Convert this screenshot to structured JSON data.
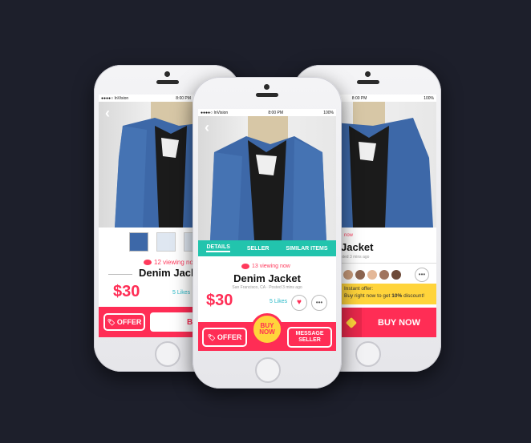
{
  "status_bar": {
    "carrier": "●●●●○ InVision",
    "time": "8:00 PM",
    "battery": "100%"
  },
  "product": {
    "title": "Denim Jacket",
    "title_partial": "Denim Jacke",
    "title_right": "Jacket",
    "price": "$30",
    "likes": "5 Likes",
    "location": "San Francisco, CA",
    "posted": "Posted 3 mins ago",
    "posted_right": "Posted 3 mins ago",
    "viewing_left": "12 viewing now",
    "viewing_center": "13 viewing now",
    "viewing_right": "now"
  },
  "tabs": [
    "DETAILS",
    "SELLER",
    "SIMILAR ITEMS"
  ],
  "actions": {
    "offer": "OFFER",
    "buy_now_line1": "BUY",
    "buy_now_line2": "NOW",
    "buy_partial": "BUY",
    "message_line1": "MESSAGE",
    "message_line2": "SELLER",
    "buy_now": "BUY NOW"
  },
  "instant_offer": {
    "label": "Instant offer:",
    "text_pre": "Buy right now to get ",
    "discount": "10%",
    "text_post": " discount!"
  },
  "colors": {
    "accent": "#ff2d55",
    "teal": "#22c4ad",
    "likes": "#27b9c7",
    "yellow": "#ffd43b",
    "background": "#1d1f2b"
  }
}
